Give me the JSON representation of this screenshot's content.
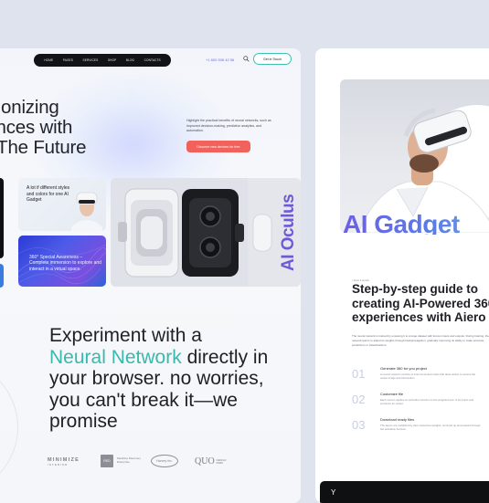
{
  "left_page": {
    "nav": {
      "items": [
        "HOME",
        "PAGES",
        "SERVICES",
        "SHOP",
        "BLOG",
        "CONTACTS"
      ],
      "phone": "+1 800 536 42 56",
      "cta": "Get in Touch"
    },
    "hero": {
      "line1": "utionizing",
      "line2": "iences with",
      "line3_accent": "I",
      "line3_rest": ": The Future",
      "description": "Highlight the practical benefits of neural networks, such as improved decision-making, predictive analytics, and automation.",
      "button": "Discover new devices for free"
    },
    "tiles": {
      "gadget_text": "A lot if different styles and colors for one AI Gadget",
      "special_text": "360° Special Awareness – Complete immersion to explore and interact in a virtual space.",
      "oculus": "AI Oculus"
    },
    "tagline": {
      "part1": "Experiment with a",
      "accent": "Neural Network",
      "part2": "directly in your browser. no worries, you can't break it—we promise"
    },
    "logos": [
      {
        "name": "MINIMIZE",
        "sub": "INTERIOR"
      },
      {
        "name": "RED",
        "sub": "Medicine Discovery Enterprise"
      },
      {
        "name": "Harvey Inc."
      },
      {
        "name": "QUO",
        "sub": "DESIGN PARK"
      }
    ]
  },
  "right_page": {
    "image_title": "AI Gadget",
    "breadcrumb": "• How it works",
    "title": "Step-by-step guide to creating AI-Powered 360 experiences with Aiero",
    "body": "The neural network is trained by exposing it to a large dataset with known inputs and outputs. During training, the network learns to adjust its weights through backpropagation, gradually improving its ability to make accurate predictions or classifications.",
    "steps": [
      {
        "num": "01",
        "title": "Generate 360 for you project",
        "desc": "A neural network consists of interconnected nodes that takes action to access the output image and information."
      },
      {
        "num": "02",
        "title": "Customize file",
        "desc": "Each neuron applies an activation function to the weighted sum of its inputs and produces an output."
      },
      {
        "num": "03",
        "title": "Download ready files",
        "desc": "The layers are multiplied by their respective weights, summed up and passed through the activation function."
      }
    ],
    "footer_glyph": "Y"
  },
  "colors": {
    "background": "#dfe3ee",
    "accent_blue": "#4e5dd9",
    "accent_teal": "#38b9ad",
    "accent_coral": "#f0625b",
    "accent_purple": "#6b5bd8"
  }
}
